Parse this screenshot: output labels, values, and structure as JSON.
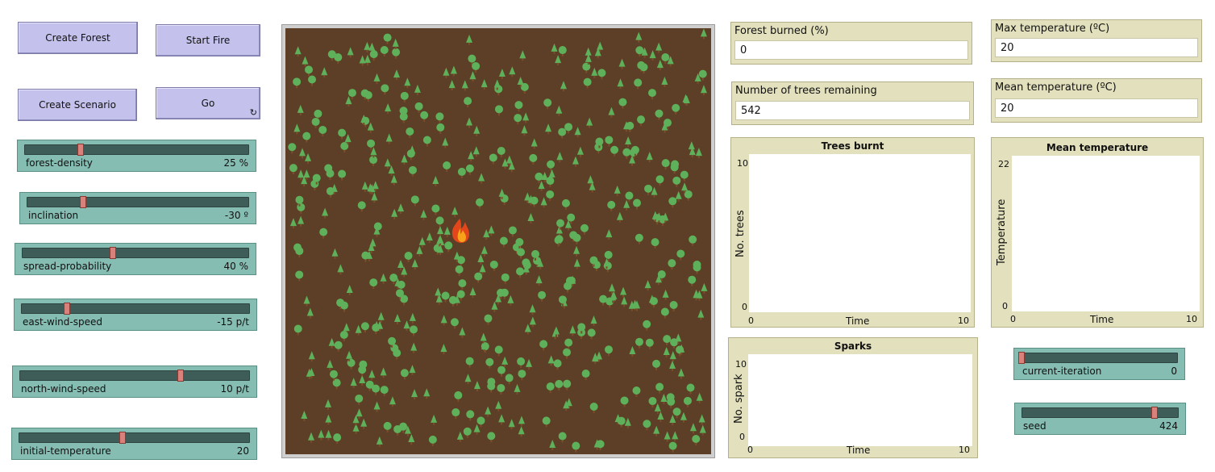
{
  "buttons": {
    "create_forest": "Create Forest",
    "start_fire": "Start Fire",
    "create_scenario": "Create Scenario",
    "go": "Go"
  },
  "sliders": {
    "forest_density": {
      "label": "forest-density",
      "value": "25 %",
      "fraction": 0.25
    },
    "inclination": {
      "label": "inclination",
      "value": "-30 º",
      "fraction": 0.25
    },
    "spread_probability": {
      "label": "spread-probability",
      "value": "40 %",
      "fraction": 0.4
    },
    "east_wind_speed": {
      "label": "east-wind-speed",
      "value": "-15 p/t",
      "fraction": 0.2
    },
    "north_wind_speed": {
      "label": "north-wind-speed",
      "value": "10 p/t",
      "fraction": 0.7
    },
    "initial_temperature": {
      "label": "initial-temperature",
      "value": "20",
      "fraction": 0.45
    },
    "current_iteration": {
      "label": "current-iteration",
      "value": "0",
      "fraction": 0.0
    },
    "seed": {
      "label": "seed",
      "value": "424",
      "fraction": 0.85
    }
  },
  "monitors": {
    "forest_burned": {
      "label": "Forest burned (%)",
      "value": "0"
    },
    "trees_remaining": {
      "label": "Number of trees remaining",
      "value": "542"
    },
    "max_temperature": {
      "label": "Max temperature (ºC)",
      "value": "20"
    },
    "mean_temperature": {
      "label": "Mean temperature (ºC)",
      "value": "20"
    }
  },
  "plots": {
    "trees_burnt": {
      "title": "Trees burnt",
      "ylabel": "No. trees",
      "xlabel": "Time",
      "ymax": "10",
      "ymin": "0",
      "xmin": "0",
      "xmax": "10"
    },
    "mean_temperature": {
      "title": "Mean temperature",
      "ylabel": "Temperature",
      "xlabel": "Time",
      "ymax": "22",
      "ymin": "0",
      "xmin": "0",
      "xmax": "10"
    },
    "sparks": {
      "title": "Sparks",
      "ylabel": "No. spark",
      "xlabel": "Time",
      "ymax": "10",
      "ymin": "0",
      "xmin": "0",
      "xmax": "10"
    }
  },
  "world": {
    "ground_color": "#5c3f26",
    "tree_color": "#5fb05a",
    "trunk_color": "#7a4e2a",
    "tree_count": 542,
    "fire_icon": "fire-icon"
  }
}
